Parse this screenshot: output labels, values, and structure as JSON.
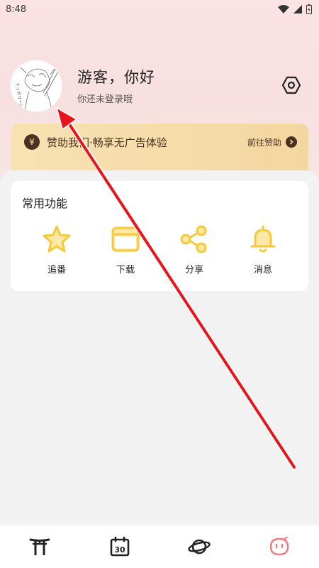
{
  "status_bar": {
    "time": "8:48"
  },
  "profile": {
    "greeting": "游客，你好",
    "login_hint": "你还未登录哦",
    "avatar_icon": "sketch-avatar",
    "avatar_caption": "ナッカリーン"
  },
  "sponsor": {
    "icon": "yen-icon",
    "symbol": "¥",
    "text": "赞助我们·畅享无广告体验",
    "link_label": "前往赞助"
  },
  "functions": {
    "title": "常用功能",
    "items": [
      {
        "label": "追番",
        "icon": "star-icon"
      },
      {
        "label": "下载",
        "icon": "folder-icon"
      },
      {
        "label": "分享",
        "icon": "share-icon"
      },
      {
        "label": "消息",
        "icon": "bell-icon"
      }
    ]
  },
  "bottom_nav": {
    "items": [
      {
        "icon": "torii-icon"
      },
      {
        "icon": "calendar-icon",
        "text": "30"
      },
      {
        "icon": "planet-icon"
      },
      {
        "icon": "profile-face-icon",
        "active": true
      }
    ]
  },
  "colors": {
    "accent_yellow": "#f5c93b",
    "sponsor_gold": "#f3d7a0",
    "dark_brown": "#4a3120",
    "active_pink": "#f27a7a",
    "annotation_red": "#e8141b"
  }
}
